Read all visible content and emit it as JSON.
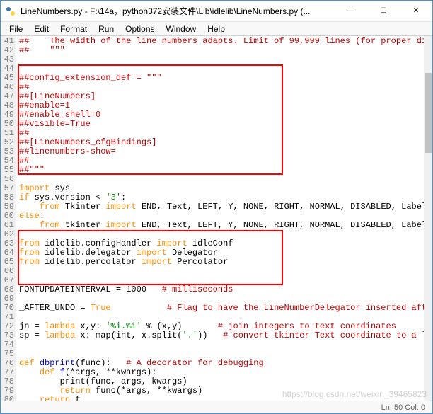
{
  "window": {
    "title": "LineNumbers.py - F:\\14a，python372安装文件\\Lib\\idlelib\\LineNumbers.py (...",
    "icon_name": "python-idle-icon"
  },
  "win_controls": {
    "min": "—",
    "max": "☐",
    "close": "✕"
  },
  "menubar": [
    {
      "label": "File",
      "u": 0
    },
    {
      "label": "Edit",
      "u": 0
    },
    {
      "label": "Format",
      "u": 1
    },
    {
      "label": "Run",
      "u": 0
    },
    {
      "label": "Options",
      "u": 0
    },
    {
      "label": "Window",
      "u": 0
    },
    {
      "label": "Help",
      "u": 0
    }
  ],
  "first_line_number": 41,
  "code_lines": [
    {
      "t": "com",
      "text": "##    The width of the line numbers adapts. Limit of 99,999 lines (for proper di"
    },
    {
      "t": "com",
      "text": "##    \"\"\""
    },
    {
      "t": "com",
      "text": ""
    },
    {
      "t": "com",
      "text": ""
    },
    {
      "t": "com",
      "text": "##config_extension_def = \"\"\""
    },
    {
      "t": "com",
      "text": "##"
    },
    {
      "t": "com",
      "text": "##[LineNumbers]"
    },
    {
      "t": "com",
      "text": "##enable=1"
    },
    {
      "t": "com",
      "text": "##enable_shell=0"
    },
    {
      "t": "com",
      "text": "##visible=True"
    },
    {
      "t": "com",
      "text": "##"
    },
    {
      "t": "com",
      "text": "##[LineNumbers_cfgBindings]"
    },
    {
      "t": "com",
      "text": "##linenumbers-show="
    },
    {
      "t": "com",
      "text": "##"
    },
    {
      "t": "com",
      "text": "##\"\"\""
    },
    {
      "t": "blank",
      "text": ""
    },
    {
      "t": "mix",
      "tokens": [
        [
          "kw",
          "import"
        ],
        [
          "txt",
          " sys"
        ]
      ]
    },
    {
      "t": "mix",
      "tokens": [
        [
          "kw",
          "if"
        ],
        [
          "txt",
          " sys.version < "
        ],
        [
          "str",
          "'3'"
        ],
        [
          "txt",
          ":"
        ]
      ]
    },
    {
      "t": "mix",
      "tokens": [
        [
          "txt",
          "    "
        ],
        [
          "kw",
          "from"
        ],
        [
          "txt",
          " Tkinter "
        ],
        [
          "kw",
          "import"
        ],
        [
          "txt",
          " END, Text, LEFT, Y, NONE, RIGHT, NORMAL, DISABLED, Label"
        ]
      ]
    },
    {
      "t": "mix",
      "tokens": [
        [
          "kw",
          "else"
        ],
        [
          "txt",
          ":"
        ]
      ]
    },
    {
      "t": "mix",
      "tokens": [
        [
          "txt",
          "    "
        ],
        [
          "kw",
          "from"
        ],
        [
          "txt",
          " tkinter "
        ],
        [
          "kw",
          "import"
        ],
        [
          "txt",
          " END, Text, LEFT, Y, NONE, RIGHT, NORMAL, DISABLED, Label"
        ]
      ]
    },
    {
      "t": "blank",
      "text": ""
    },
    {
      "t": "mix",
      "tokens": [
        [
          "kw",
          "from"
        ],
        [
          "txt",
          " idlelib.configHandler "
        ],
        [
          "kw",
          "import"
        ],
        [
          "txt",
          " idleConf"
        ]
      ]
    },
    {
      "t": "mix",
      "tokens": [
        [
          "kw",
          "from"
        ],
        [
          "txt",
          " idlelib.delegator "
        ],
        [
          "kw",
          "import"
        ],
        [
          "txt",
          " Delegator"
        ]
      ]
    },
    {
      "t": "mix",
      "tokens": [
        [
          "kw",
          "from"
        ],
        [
          "txt",
          " idlelib.percolator "
        ],
        [
          "kw",
          "import"
        ],
        [
          "txt",
          " Percolator"
        ]
      ]
    },
    {
      "t": "blank",
      "text": ""
    },
    {
      "t": "blank",
      "text": ""
    },
    {
      "t": "mix",
      "tokens": [
        [
          "txt",
          "FONTUPDATEINTERVAL = 1000   "
        ],
        [
          "com",
          "# milliseconds"
        ]
      ]
    },
    {
      "t": "blank",
      "text": ""
    },
    {
      "t": "mix",
      "tokens": [
        [
          "txt",
          "_AFTER_UNDO = "
        ],
        [
          "kw",
          "True"
        ],
        [
          "txt",
          "           "
        ],
        [
          "com",
          "# Flag to have the LineNumberDelegator inserted afte"
        ]
      ]
    },
    {
      "t": "blank",
      "text": ""
    },
    {
      "t": "mix",
      "tokens": [
        [
          "txt",
          "jn = "
        ],
        [
          "kw",
          "lambda"
        ],
        [
          "txt",
          " x,y: "
        ],
        [
          "str",
          "'%i.%i'"
        ],
        [
          "txt",
          " % (x,y)       "
        ],
        [
          "com",
          "# join integers to text coordinates"
        ]
      ]
    },
    {
      "t": "mix",
      "tokens": [
        [
          "txt",
          "sp = "
        ],
        [
          "kw",
          "lambda"
        ],
        [
          "txt",
          " x: map(int, x.split("
        ],
        [
          "str",
          "'.'"
        ],
        [
          "txt",
          "))   "
        ],
        [
          "com",
          "# convert tkinter Text coordinate to a l"
        ]
      ]
    },
    {
      "t": "blank",
      "text": ""
    },
    {
      "t": "blank",
      "text": ""
    },
    {
      "t": "mix",
      "tokens": [
        [
          "kw",
          "def"
        ],
        [
          "txt",
          " "
        ],
        [
          "def",
          "dbprint"
        ],
        [
          "txt",
          "(func):   "
        ],
        [
          "com",
          "# A decorator for debugging"
        ]
      ]
    },
    {
      "t": "mix",
      "tokens": [
        [
          "txt",
          "    "
        ],
        [
          "kw",
          "def"
        ],
        [
          "txt",
          " "
        ],
        [
          "def",
          "f"
        ],
        [
          "txt",
          "(*args, **kwargs):"
        ]
      ]
    },
    {
      "t": "mix",
      "tokens": [
        [
          "txt",
          "        print(func, args, kwargs)"
        ]
      ]
    },
    {
      "t": "mix",
      "tokens": [
        [
          "txt",
          "        "
        ],
        [
          "kw",
          "return"
        ],
        [
          "txt",
          " func(*args, **kwargs)"
        ]
      ]
    },
    {
      "t": "mix",
      "tokens": [
        [
          "txt",
          "    "
        ],
        [
          "kw",
          "return"
        ],
        [
          "txt",
          " f"
        ]
      ]
    }
  ],
  "red_boxes": [
    {
      "from_line": 44,
      "to_line": 55
    },
    {
      "from_line": 62,
      "to_line": 67
    }
  ],
  "statusbar": {
    "position": "Ln: 50  Col: 0"
  },
  "watermark": "https://blog.csdn.net/weixin_39465823",
  "scrollbar": {
    "thumb_top_pct": 10,
    "thumb_height_pct": 22
  }
}
